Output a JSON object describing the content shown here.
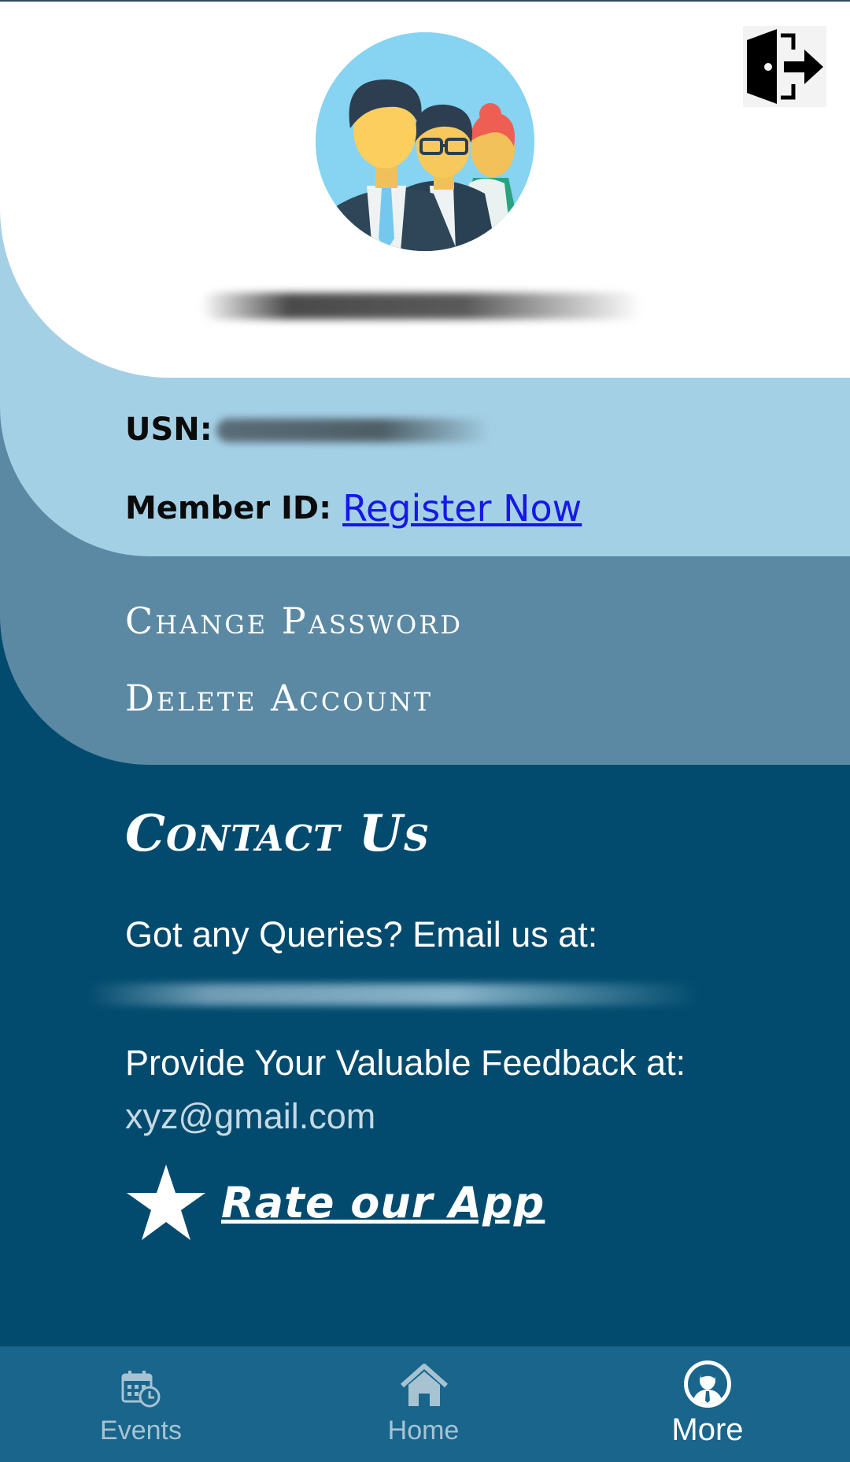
{
  "profile": {
    "usn_label": "USN:",
    "member_id_label": "Member ID:",
    "register_link": "Register Now"
  },
  "account_menu": [
    {
      "label": "Change Password"
    },
    {
      "label": "Delete Account"
    }
  ],
  "contact": {
    "title": "Contact Us",
    "queries_text": "Got any Queries? Email us at:",
    "feedback_text": "Provide Your Valuable Feedback at:",
    "feedback_email": "xyz@gmail.com",
    "rate_label": "Rate our App"
  },
  "bottom_nav": {
    "items": [
      {
        "label": "Events",
        "icon": "calendar-clock-icon",
        "active": false
      },
      {
        "label": "Home",
        "icon": "home-icon",
        "active": false
      },
      {
        "label": "More",
        "icon": "user-profile-icon",
        "active": true
      }
    ]
  },
  "colors": {
    "background_dark": "#024b6e",
    "panel_mid": "#5b89a3",
    "panel_light": "#a4d0e6",
    "nav_bar": "#19658c",
    "link": "#1518e6"
  }
}
